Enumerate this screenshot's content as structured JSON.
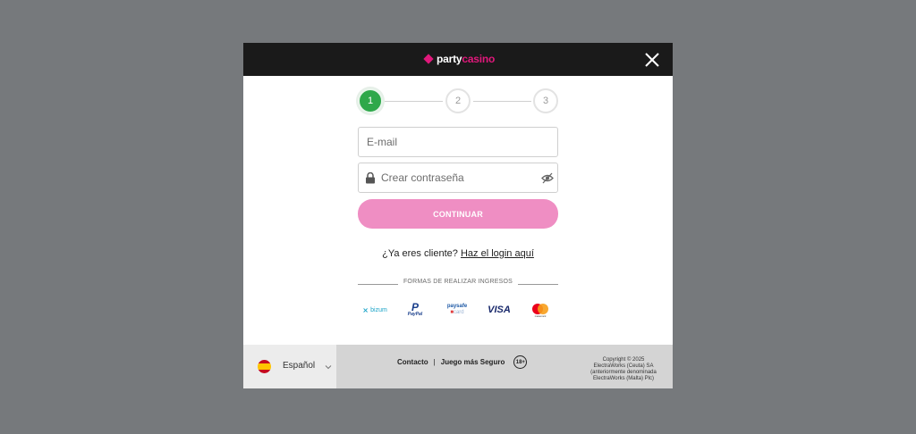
{
  "brand": {
    "name_part1": "party",
    "name_part2": "casino",
    "accent_color": "#e0187b"
  },
  "stepper": {
    "steps": [
      "1",
      "2",
      "3"
    ],
    "active_step": "1",
    "active_color": "#2ea84a"
  },
  "form": {
    "email_placeholder": "E-mail",
    "email_value": "",
    "password_placeholder": "Crear contraseña",
    "password_value": "",
    "continue_label": "CONTINUAR",
    "continue_color": "#ef8ec3"
  },
  "login": {
    "prompt": "¿Ya eres cliente?",
    "link_label": "Haz el login aquí"
  },
  "deposits": {
    "title": "FORMAS DE REALIZAR INGRESOS",
    "methods": [
      {
        "name": "bizum",
        "label": "bizum"
      },
      {
        "name": "paypal",
        "label": "PayPal"
      },
      {
        "name": "paysafecard",
        "label_top": "paysafe",
        "label_bottom": "card"
      },
      {
        "name": "visa",
        "label": "VISA"
      },
      {
        "name": "mastercard",
        "label": "mastercard"
      }
    ]
  },
  "footer": {
    "language_label": "Español",
    "links": [
      "Contacto",
      "Juego más Seguro"
    ],
    "separator": "|",
    "age_badge": "18+",
    "copyright_lines": [
      "Copyright © 2025",
      "ElectraWorks (Ceuta) SA",
      "(anteriormente denominada",
      "ElectraWorks (Malta) Plc)"
    ]
  },
  "icons": {
    "close": "close-icon",
    "lock": "lock-icon",
    "eye": "eye-slash-icon",
    "flag": "spain-flag-icon",
    "chevron": "chevron-down-icon"
  }
}
